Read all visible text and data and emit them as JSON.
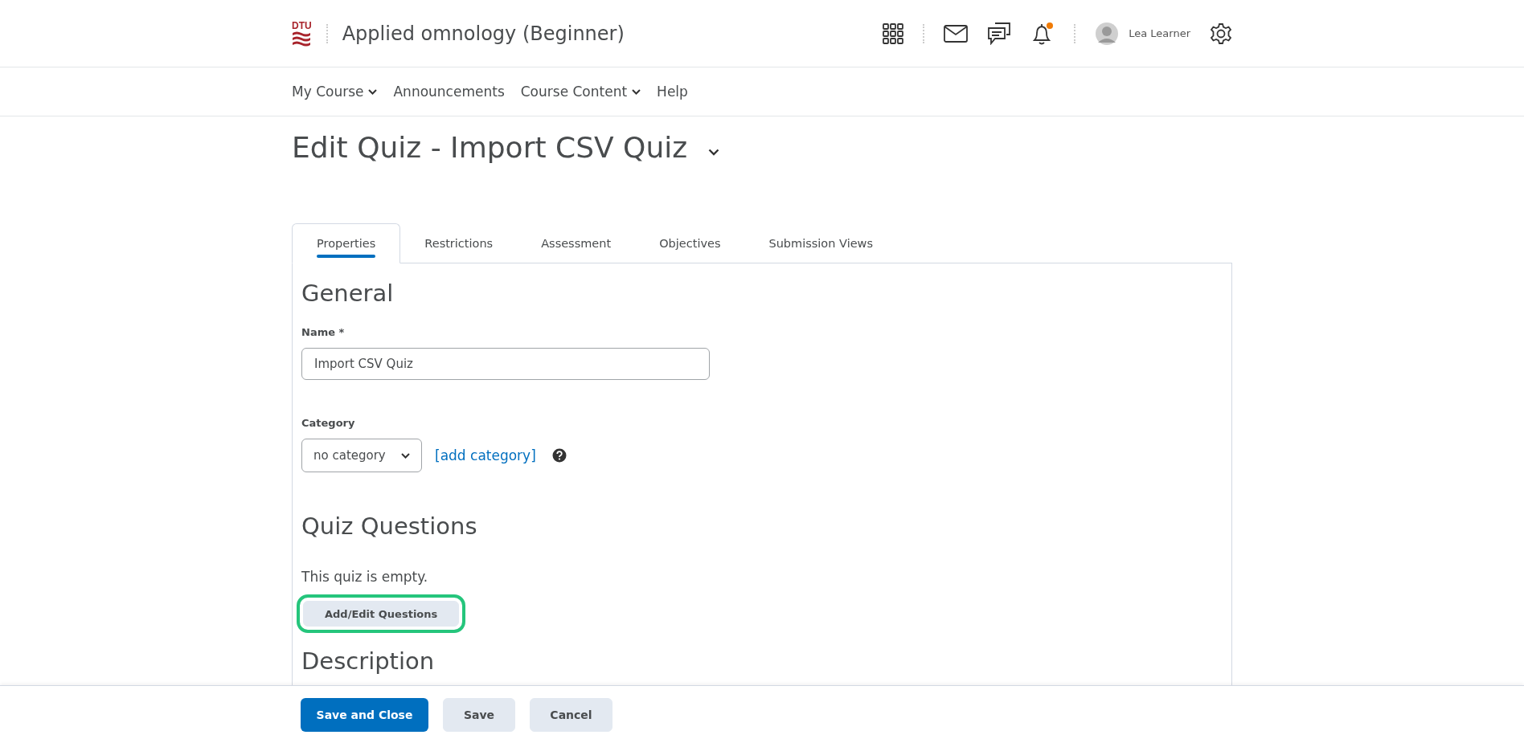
{
  "header": {
    "logo": "DTU",
    "course_title": "Applied omnology (Beginner)",
    "notifications_unread": true,
    "user_name": "Lea Learner"
  },
  "nav": [
    {
      "label": "My Course",
      "dropdown": true
    },
    {
      "label": "Announcements",
      "dropdown": false
    },
    {
      "label": "Course Content",
      "dropdown": true
    },
    {
      "label": "Help",
      "dropdown": false
    }
  ],
  "page_title": "Edit Quiz - Import CSV Quiz",
  "tabs": [
    {
      "label": "Properties",
      "selected": true
    },
    {
      "label": "Restrictions",
      "selected": false
    },
    {
      "label": "Assessment",
      "selected": false
    },
    {
      "label": "Objectives",
      "selected": false
    },
    {
      "label": "Submission Views",
      "selected": false
    }
  ],
  "general": {
    "heading": "General",
    "name_label": "Name",
    "required_mark": "*",
    "name_value": "Import CSV Quiz",
    "category_label": "Category",
    "category_value": "no category",
    "add_category_link": "[add category]"
  },
  "quiz_questions": {
    "heading": "Quiz Questions",
    "empty_text": "This quiz is empty.",
    "button": "Add/Edit Questions",
    "highlighted": true
  },
  "description": {
    "heading": "Description"
  },
  "footer_buttons": [
    {
      "label": "Save and Close",
      "kind": "primary"
    },
    {
      "label": "Save",
      "kind": "secondary"
    },
    {
      "label": "Cancel",
      "kind": "secondary"
    }
  ]
}
